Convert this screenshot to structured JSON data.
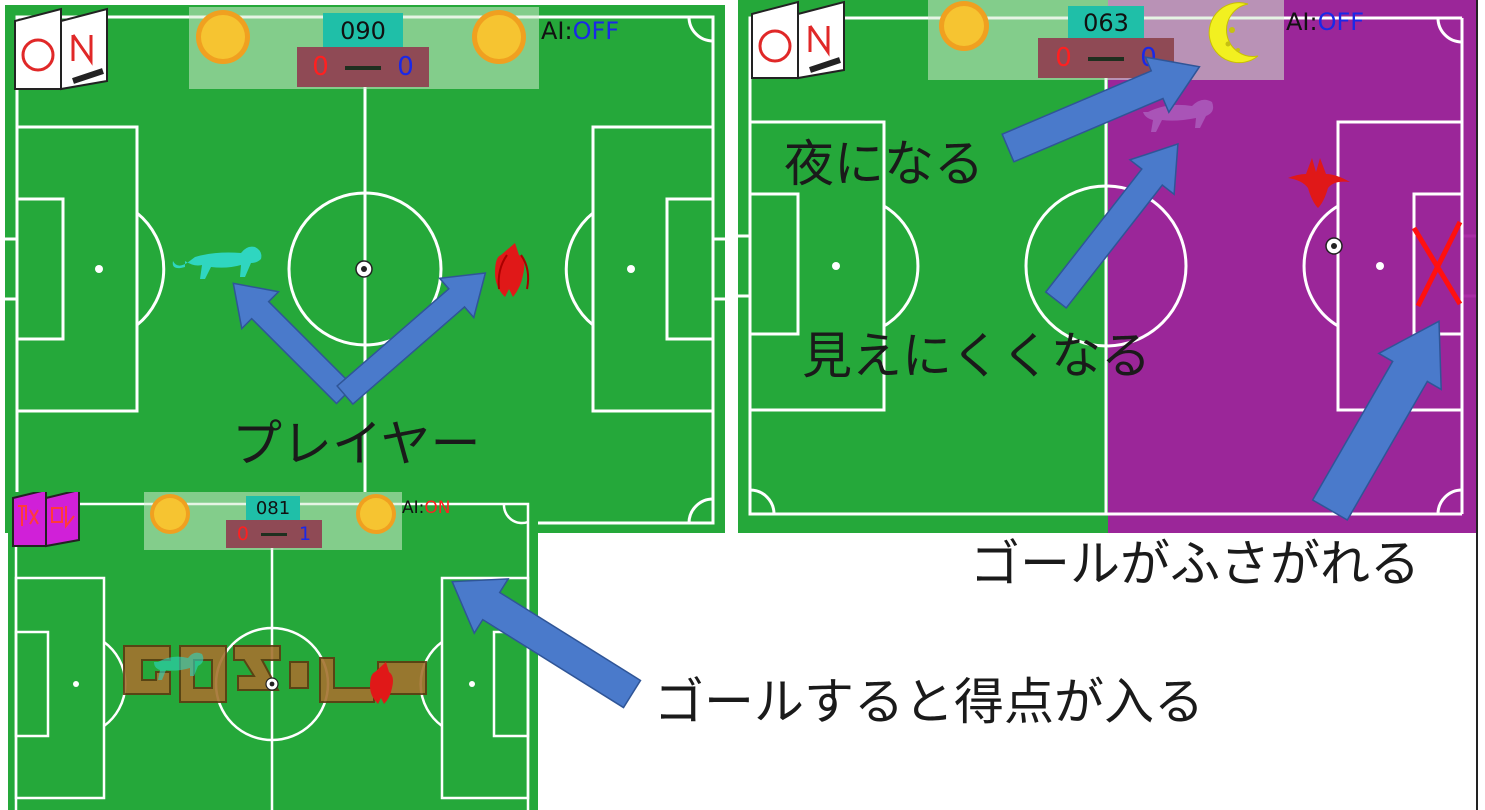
{
  "panels": {
    "top_left": {
      "timer": "090",
      "score": {
        "red": "0",
        "blue": "0"
      },
      "ai_prefix": "AI:",
      "ai_state": "OFF",
      "sign_icon": "on-sign-icon",
      "weather_icons": [
        "sun-icon",
        "sun-icon"
      ]
    },
    "top_right": {
      "timer": "063",
      "score": {
        "red": "0",
        "blue": "0"
      },
      "ai_prefix": "AI:",
      "ai_state": "OFF",
      "sign_icon": "on-sign-icon",
      "weather_icons": [
        "sun-icon",
        "moon-icon"
      ]
    },
    "bottom_left": {
      "timer": "081",
      "score": {
        "red": "0",
        "blue": "1"
      },
      "ai_prefix": "AI:",
      "ai_state": "ON",
      "sign_icon": "magenta-sign-icon",
      "weather_icons": [
        "sun-icon",
        "sun-icon"
      ]
    }
  },
  "annotations": {
    "player": "プレイヤー",
    "night": "夜になる",
    "hard_to_see": "見えにくくなる",
    "goal_blocked": "ゴールがふさがれる",
    "goal_scores": "ゴールすると得点が入る"
  },
  "colors": {
    "pitch": "#25a83a",
    "night_overlay": "#a020a0",
    "arrow": "#4a7acb",
    "red_team": "#ff2020",
    "blue_team": "#1a28e8",
    "lion_player": "#2fd6c0",
    "bat_player": "#e01818"
  }
}
